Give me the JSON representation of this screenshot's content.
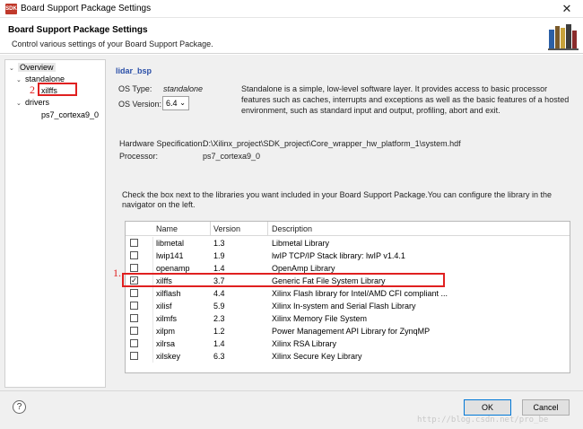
{
  "window": {
    "title": "Board Support Package Settings",
    "logo_text": "SDK",
    "close_symbol": "✕"
  },
  "header": {
    "title": "Board Support Package Settings",
    "description": "Control various settings of your Board Support Package."
  },
  "tree": {
    "overview": "Overview",
    "standalone": "standalone",
    "xilffs": "xilffs",
    "drivers": "drivers",
    "ps7_cortexa9_0": "ps7_cortexa9_0"
  },
  "annotations": {
    "one": "1.",
    "two": "2"
  },
  "overview": {
    "bsp_name": "lidar_bsp",
    "os_type_label": "OS Type:",
    "os_type_value": "standalone",
    "os_version_label": "OS Version:",
    "os_version_value": "6.4",
    "os_description": "Standalone is a simple, low-level software layer. It provides access to basic processor features such as caches, interrupts and exceptions as well as the basic features of a hosted environment, such as standard input and output, profiling, abort and exit.",
    "hw_spec_label": "Hardware Specification:",
    "hw_spec_value": "D:\\Xilinx_project\\SDK_project\\Core_wrapper_hw_platform_1\\system.hdf",
    "processor_label": "Processor:",
    "processor_value": "ps7_cortexa9_0",
    "libraries_instruction": "Check the box next to the libraries you want included in your Board Support Package.You can configure the library in the navigator on the left."
  },
  "libraries": {
    "headers": {
      "name": "Name",
      "version": "Version",
      "description": "Description"
    },
    "rows": [
      {
        "checked": false,
        "name": "libmetal",
        "version": "1.3",
        "description": "Libmetal Library"
      },
      {
        "checked": false,
        "name": "lwip141",
        "version": "1.9",
        "description": "lwIP TCP/IP Stack library: lwIP v1.4.1"
      },
      {
        "checked": false,
        "name": "openamp",
        "version": "1.4",
        "description": "OpenAmp Library"
      },
      {
        "checked": true,
        "name": "xilffs",
        "version": "3.7",
        "description": "Generic Fat File System Library"
      },
      {
        "checked": false,
        "name": "xilflash",
        "version": "4.4",
        "description": "Xilinx Flash library for Intel/AMD CFI compliant ..."
      },
      {
        "checked": false,
        "name": "xilisf",
        "version": "5.9",
        "description": "Xilinx In-system and Serial Flash Library"
      },
      {
        "checked": false,
        "name": "xilmfs",
        "version": "2.3",
        "description": "Xilinx Memory File System"
      },
      {
        "checked": false,
        "name": "xilpm",
        "version": "1.2",
        "description": "Power Management API Library for ZynqMP"
      },
      {
        "checked": false,
        "name": "xilrsa",
        "version": "1.4",
        "description": "Xilinx RSA Library"
      },
      {
        "checked": false,
        "name": "xilskey",
        "version": "6.3",
        "description": "Xilinx Secure Key Library"
      }
    ]
  },
  "footer": {
    "help_symbol": "?",
    "ok_label": "OK",
    "cancel_label": "Cancel"
  },
  "watermark": "http://blog.csdn.net/pro_be"
}
